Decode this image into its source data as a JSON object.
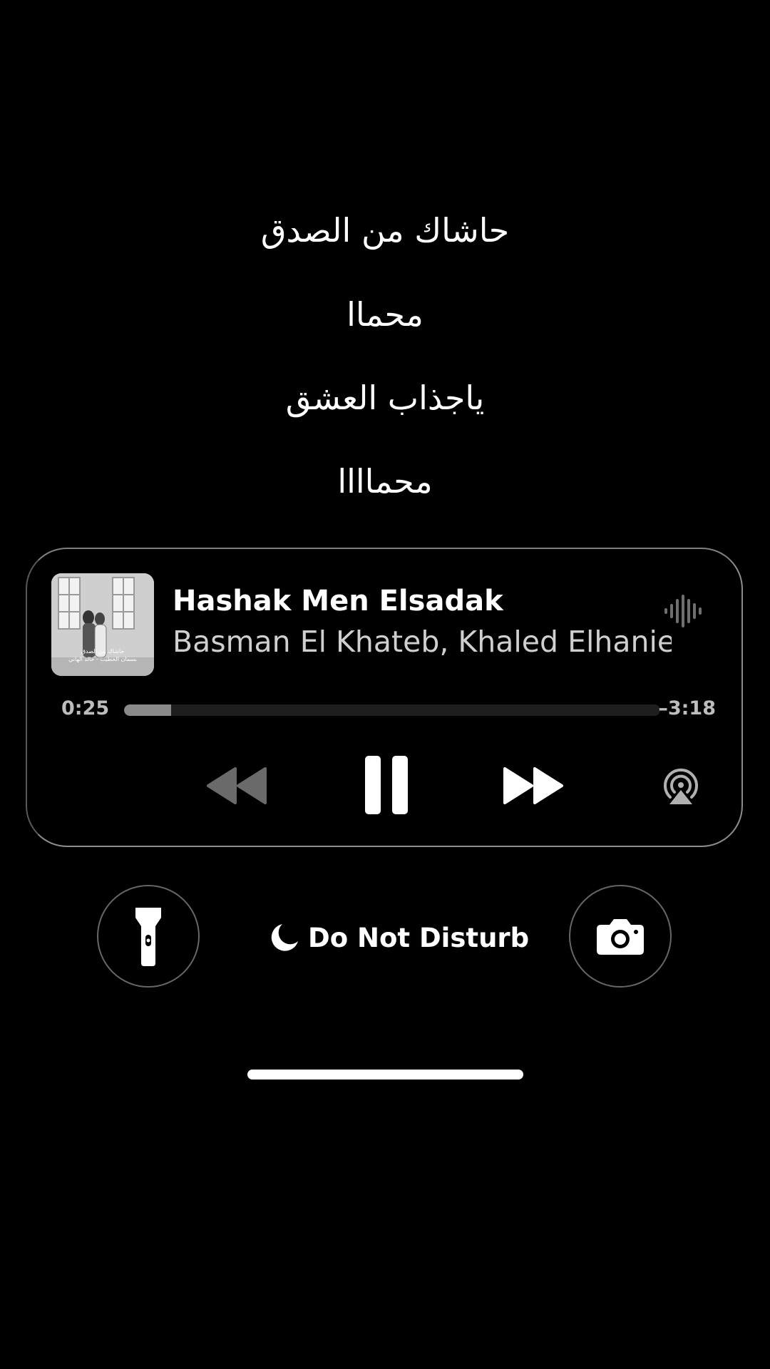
{
  "lyrics": {
    "lines": [
      "حاشاك من الصدق",
      "محماا",
      "ياجذاب العشق",
      "محماااا"
    ]
  },
  "now_playing": {
    "title": "Hashak Men Elsadak",
    "artist": "Basman El Khateb, Khaled Elhanie",
    "artwork_text": [
      "حاشاك من الصدق",
      "بسمان الخطيب - خالد الهاني"
    ],
    "elapsed": "0:25",
    "remaining": "–3:18",
    "progress": 0.088,
    "icons": {
      "waveform": "waveform-icon",
      "rewind": "rewind-icon",
      "pause": "pause-icon",
      "forward": "fast-forward-icon",
      "airplay": "airplay-icon"
    }
  },
  "dock": {
    "flashlight_icon": "flashlight-icon",
    "focus_label": "Do Not Disturb",
    "focus_icon": "moon-icon",
    "camera_icon": "camera-icon"
  },
  "colors": {
    "background": "#000000",
    "text_primary": "#ffffff",
    "text_secondary": "#cfcfcf",
    "progress_fill": "#8a8a8a"
  }
}
